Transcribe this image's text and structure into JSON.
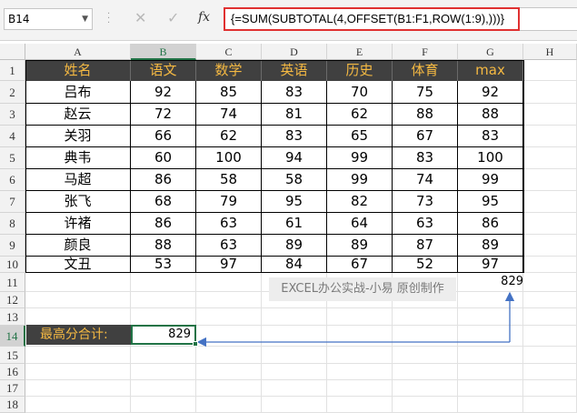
{
  "name_box": "B14",
  "toolbar": {
    "cancel_glyph": "✕",
    "enter_glyph": "✓",
    "fx_label": "fx"
  },
  "formula": "{=SUM(SUBTOTAL(4,OFFSET(B1:F1,ROW(1:9),)))}",
  "columns": [
    "A",
    "B",
    "C",
    "D",
    "E",
    "F",
    "G",
    "H"
  ],
  "rows": [
    "1",
    "2",
    "3",
    "4",
    "5",
    "6",
    "7",
    "8",
    "9",
    "10",
    "11",
    "12",
    "13",
    "14",
    "15",
    "16",
    "17",
    "18"
  ],
  "table": {
    "headers": [
      "姓名",
      "语文",
      "数学",
      "英语",
      "历史",
      "体育",
      "max"
    ],
    "data": [
      [
        "吕布",
        "92",
        "85",
        "83",
        "70",
        "75",
        "92"
      ],
      [
        "赵云",
        "72",
        "74",
        "81",
        "62",
        "88",
        "88"
      ],
      [
        "关羽",
        "66",
        "62",
        "83",
        "65",
        "67",
        "83"
      ],
      [
        "典韦",
        "60",
        "100",
        "94",
        "99",
        "83",
        "100"
      ],
      [
        "马超",
        "86",
        "58",
        "58",
        "99",
        "74",
        "99"
      ],
      [
        "张飞",
        "68",
        "79",
        "95",
        "82",
        "73",
        "95"
      ],
      [
        "许褚",
        "86",
        "63",
        "61",
        "64",
        "63",
        "86"
      ],
      [
        "颜良",
        "88",
        "63",
        "89",
        "89",
        "87",
        "89"
      ],
      [
        "文丑",
        "53",
        "97",
        "84",
        "67",
        "52",
        "97"
      ]
    ]
  },
  "watermark": "EXCEL办公实战-小易 原创制作",
  "g11_value": "829",
  "total": {
    "label": "最高分合计:",
    "value": "829"
  },
  "colors": {
    "header_bg": "#404040",
    "header_text": "#f5b942",
    "selection": "#217346",
    "formula_border": "#e03131",
    "arrow": "#4472c4"
  }
}
